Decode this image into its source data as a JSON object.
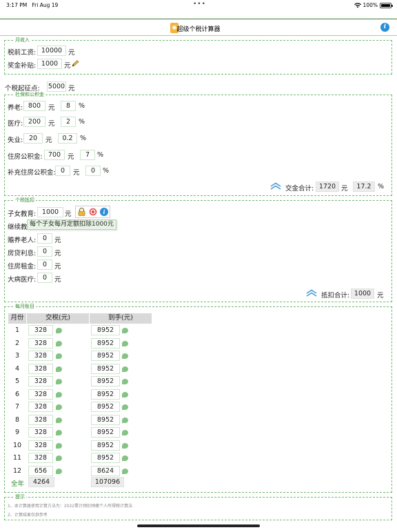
{
  "status": {
    "time": "3:17 PM",
    "date": "Fri Aug 19",
    "dots": "•••",
    "battery": "100%"
  },
  "nav": {
    "title": "超级个税计算器"
  },
  "monthly_income": {
    "legend": "月收入",
    "salary_label": "税前工资:",
    "salary_value": "10000",
    "salary_unit": "元",
    "bonus_label": "奖金补贴:",
    "bonus_value": "1000",
    "bonus_unit": "元"
  },
  "threshold": {
    "label": "个税起征点:",
    "value": "5000",
    "unit": "元"
  },
  "social": {
    "legend": "社保和公积金",
    "rows": [
      {
        "label": "养老:",
        "amount": "800",
        "unit": "元",
        "rate": "8",
        "pct": "%"
      },
      {
        "label": "医疗:",
        "amount": "200",
        "unit": "元",
        "rate": "2",
        "pct": "%"
      },
      {
        "label": "失业:",
        "amount": "20",
        "unit": "元",
        "rate": "0.2",
        "pct": "%"
      },
      {
        "label": "住房公积金:",
        "amount": "700",
        "unit": "元",
        "rate": "7",
        "pct": "%"
      },
      {
        "label": "补充住房公积金:",
        "amount": "0",
        "unit": "元",
        "rate": "0",
        "pct": "%"
      }
    ],
    "total_label": "交金合计:",
    "total_value": "1720",
    "total_unit": "元",
    "total_rate": "17.2",
    "total_pct": "%"
  },
  "deduction": {
    "legend": "个税抵扣",
    "rows": [
      {
        "label": "子女教育:",
        "value": "1000",
        "unit": "元"
      },
      {
        "label": "继续教",
        "value": "",
        "unit": ""
      },
      {
        "label": "赡养老人:",
        "value": "0",
        "unit": "元"
      },
      {
        "label": "房贷利息:",
        "value": "0",
        "unit": "元"
      },
      {
        "label": "住房租金:",
        "value": "0",
        "unit": "元"
      },
      {
        "label": "大病医疗:",
        "value": "0",
        "unit": "元"
      }
    ],
    "tooltip": "每个子女每月定额扣除1000元",
    "total_label": "抵扣合计:",
    "total_value": "1000",
    "total_unit": "元"
  },
  "monthly": {
    "legend": "每月账目",
    "headers": [
      "月份",
      "交税(元)",
      "到手(元)"
    ],
    "rows": [
      {
        "month": "1",
        "tax": "328",
        "net": "8952"
      },
      {
        "month": "2",
        "tax": "328",
        "net": "8952"
      },
      {
        "month": "3",
        "tax": "328",
        "net": "8952"
      },
      {
        "month": "4",
        "tax": "328",
        "net": "8952"
      },
      {
        "month": "5",
        "tax": "328",
        "net": "8952"
      },
      {
        "month": "6",
        "tax": "328",
        "net": "8952"
      },
      {
        "month": "7",
        "tax": "328",
        "net": "8952"
      },
      {
        "month": "8",
        "tax": "328",
        "net": "8952"
      },
      {
        "month": "9",
        "tax": "328",
        "net": "8952"
      },
      {
        "month": "10",
        "tax": "328",
        "net": "8952"
      },
      {
        "month": "11",
        "tax": "328",
        "net": "8952"
      },
      {
        "month": "12",
        "tax": "656",
        "net": "8624"
      }
    ],
    "year_label": "全年",
    "year_tax": "4264",
    "year_net": "107096"
  },
  "tips": {
    "legend": "提示",
    "lines": [
      "1、本计算器使用计算方法为：2022累计预扣预缴个人所得税计算法",
      "2、计算结果仅供参考"
    ]
  },
  "colors": {
    "accent_green": "#2f8a2f",
    "border_green": "#6fb86f",
    "info_blue": "#2a8fd6",
    "icon_orange": "#f3b53d"
  }
}
